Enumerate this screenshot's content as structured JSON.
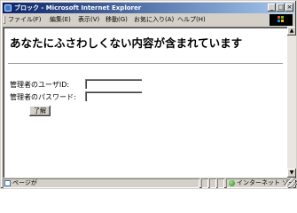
{
  "window": {
    "title": "ブロック - Microsoft Internet Explorer",
    "controls": {
      "minimize": "_",
      "maximize": "□",
      "close": "×"
    }
  },
  "menu": {
    "items": [
      "ファイル(F)",
      "編集(E)",
      "表示(V)",
      "移動(G)",
      "お気に入り(A)",
      "ヘルプ(H)"
    ]
  },
  "content": {
    "heading": "あなたにふさわしくない内容が含まれています",
    "admin_id_label": "管理者のユーザID:",
    "admin_id_value": "",
    "admin_password_label": "管理者のパスワード:",
    "admin_password_value": "",
    "ok_button": "了解"
  },
  "statusbar": {
    "page_text": "ページが",
    "zone_text": "インターネット ゾーン",
    "page_icon": "ie-page-icon",
    "zone_icon": "globe-icon"
  },
  "scrollbar": {
    "up": "▲",
    "down": "▼"
  },
  "colors": {
    "titlebar_start": "#0a246a",
    "titlebar_end": "#a6caf0",
    "chrome": "#d4d0c8",
    "content_bg": "#ffffff"
  }
}
